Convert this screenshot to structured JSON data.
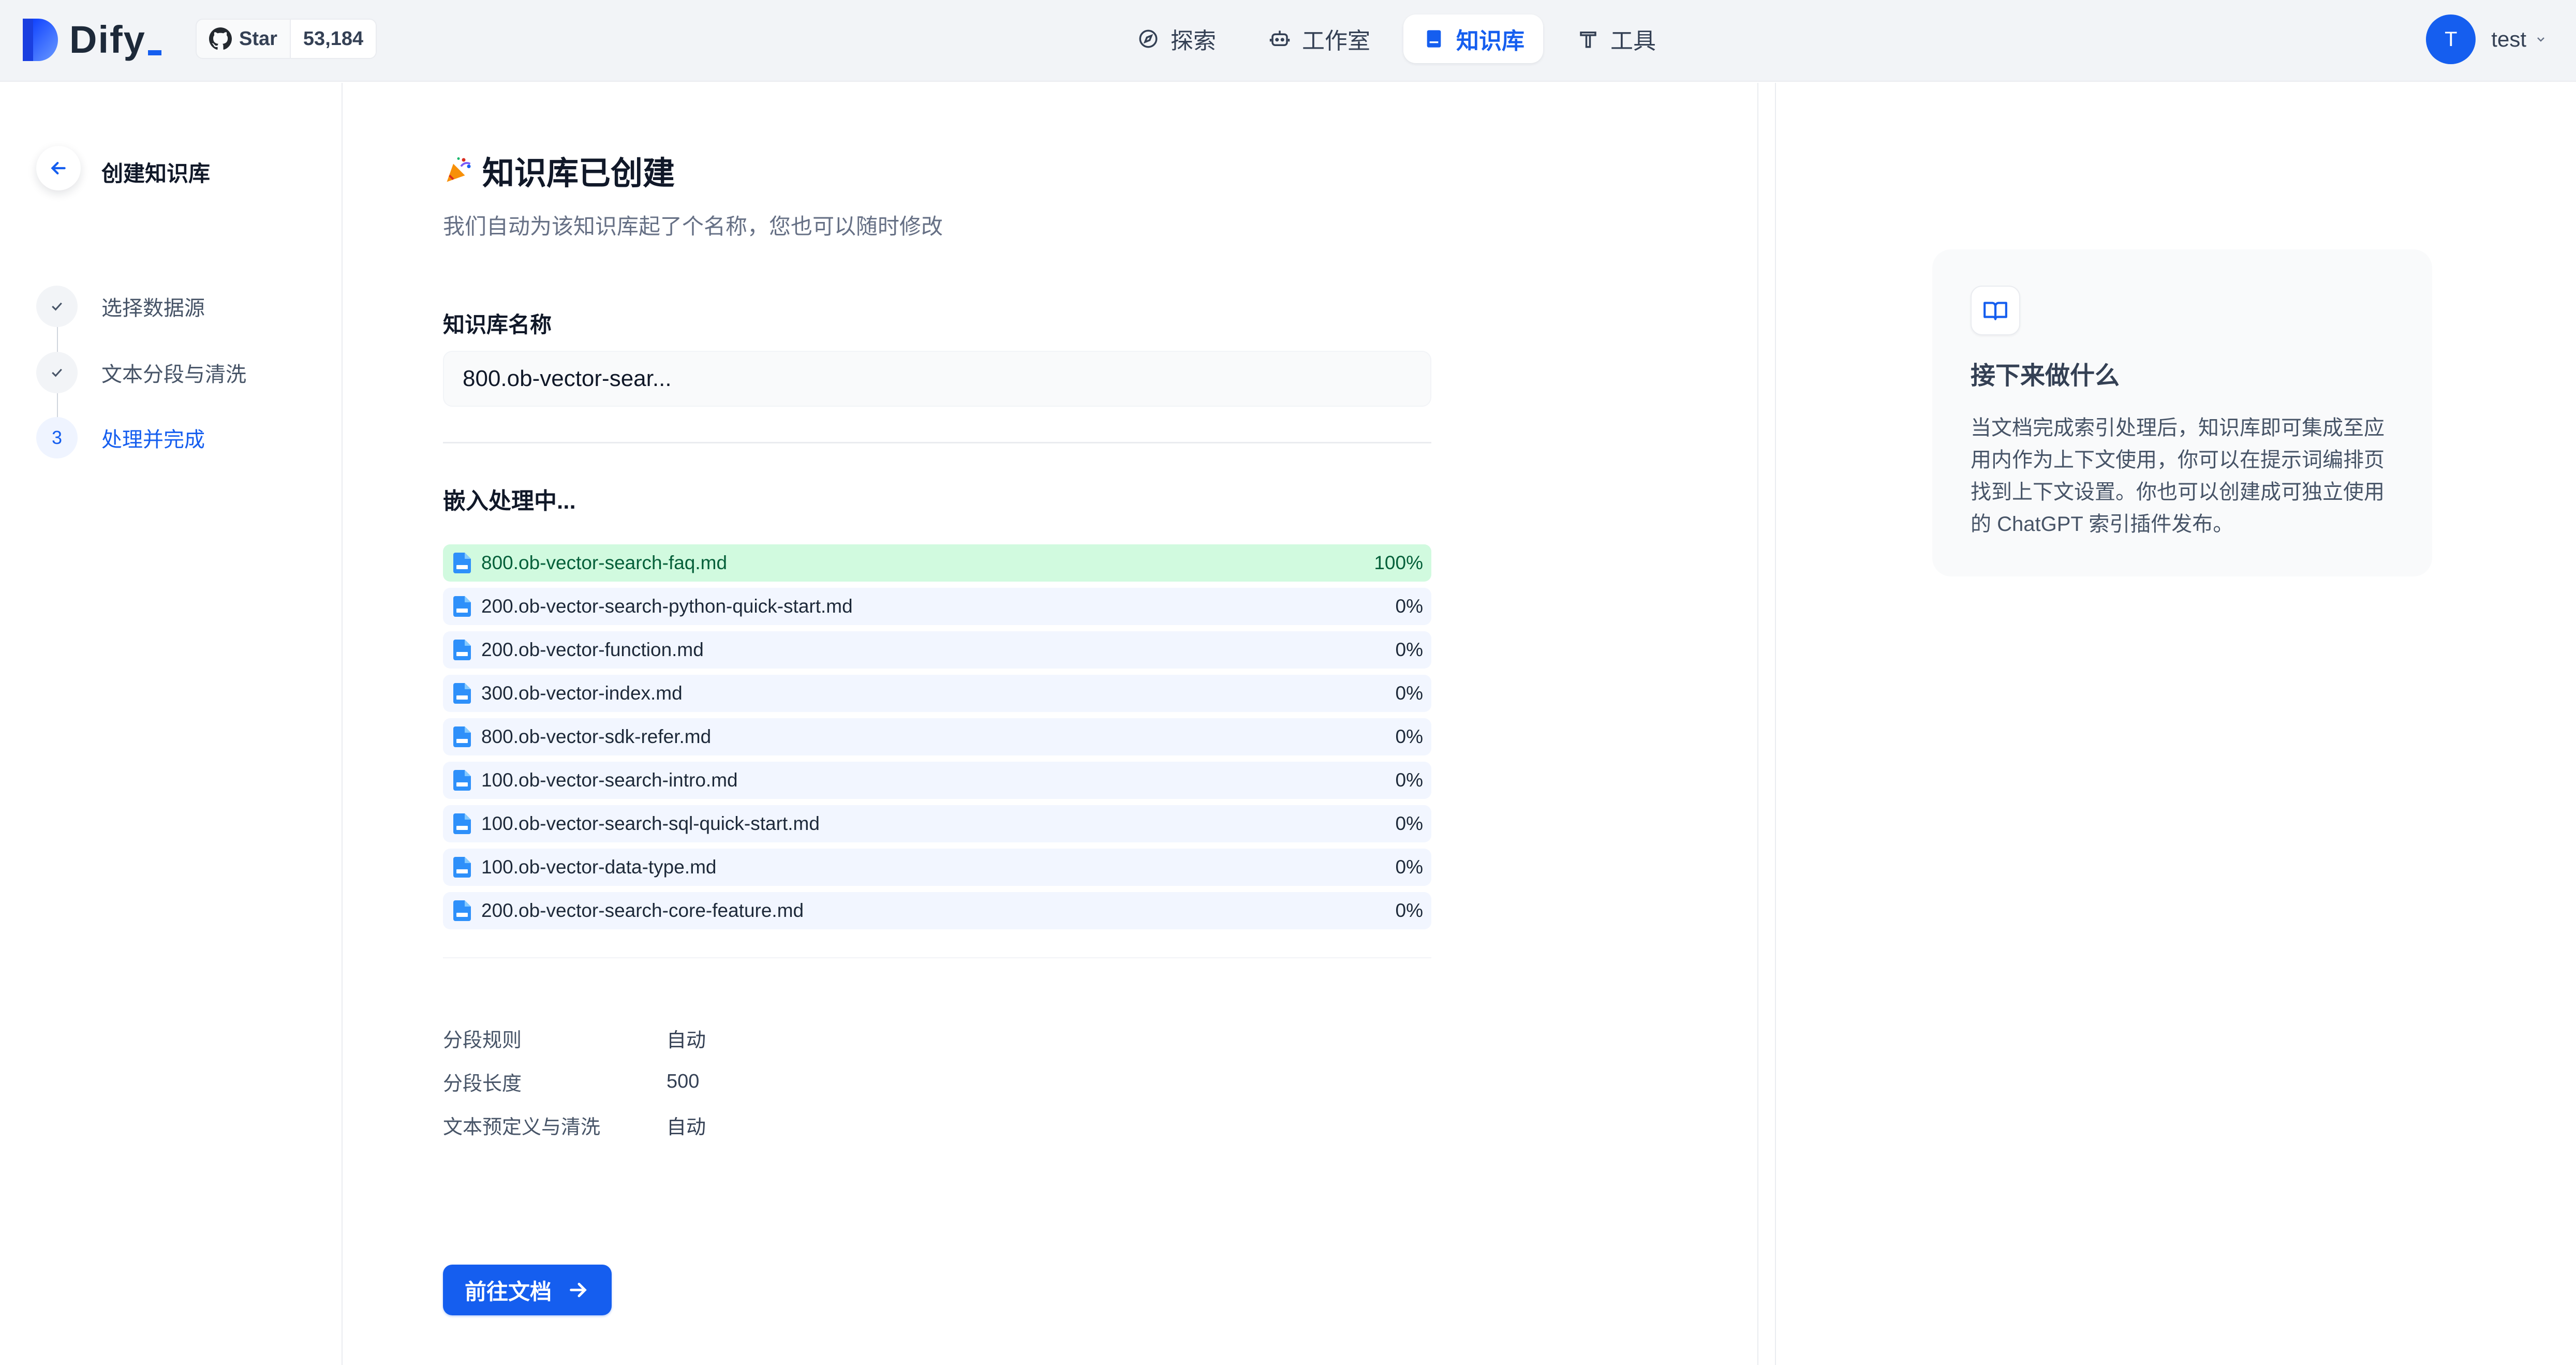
{
  "header": {
    "brand": "Dify",
    "github": {
      "star_label": "Star",
      "star_count": "53,184"
    },
    "nav": [
      {
        "label": "探索",
        "icon": "compass-icon",
        "active": false
      },
      {
        "label": "工作室",
        "icon": "robot-icon",
        "active": false
      },
      {
        "label": "知识库",
        "icon": "book-icon",
        "active": true
      },
      {
        "label": "工具",
        "icon": "hammer-icon",
        "active": false
      }
    ],
    "user": {
      "initial": "T",
      "name": "test"
    }
  },
  "steps": {
    "title": "创建知识库",
    "items": [
      {
        "label": "选择数据源",
        "status": "done"
      },
      {
        "label": "文本分段与清洗",
        "status": "done"
      },
      {
        "label": "处理并完成",
        "status": "current",
        "number": "3"
      }
    ]
  },
  "main": {
    "title": "知识库已创建",
    "subtitle": "我们自动为该知识库起了个名称，您也可以随时修改",
    "name_label": "知识库名称",
    "name_value": "800.ob-vector-sear...",
    "embedding_title": "嵌入处理中...",
    "files": [
      {
        "name": "800.ob-vector-search-faq.md",
        "progress": "100%"
      },
      {
        "name": "200.ob-vector-search-python-quick-start.md",
        "progress": "0%"
      },
      {
        "name": "200.ob-vector-function.md",
        "progress": "0%"
      },
      {
        "name": "300.ob-vector-index.md",
        "progress": "0%"
      },
      {
        "name": "800.ob-vector-sdk-refer.md",
        "progress": "0%"
      },
      {
        "name": "100.ob-vector-search-intro.md",
        "progress": "0%"
      },
      {
        "name": "100.ob-vector-search-sql-quick-start.md",
        "progress": "0%"
      },
      {
        "name": "100.ob-vector-data-type.md",
        "progress": "0%"
      },
      {
        "name": "200.ob-vector-search-core-feature.md",
        "progress": "0%"
      }
    ],
    "rules": [
      {
        "key": "分段规则",
        "value": "自动"
      },
      {
        "key": "分段长度",
        "value": "500"
      },
      {
        "key": "文本预定义与清洗",
        "value": "自动"
      }
    ],
    "go_button": "前往文档"
  },
  "side_card": {
    "title": "接下来做什么",
    "text": "当文档完成索引处理后，知识库即可集成至应用内作为上下文使用，你可以在提示词编排页找到上下文设置。你也可以创建成可独立使用的 ChatGPT 索引插件发布。"
  },
  "colors": {
    "accent": "#155eef",
    "progress_done": "#d1fadf",
    "progress_pending": "#f2f6ff"
  }
}
